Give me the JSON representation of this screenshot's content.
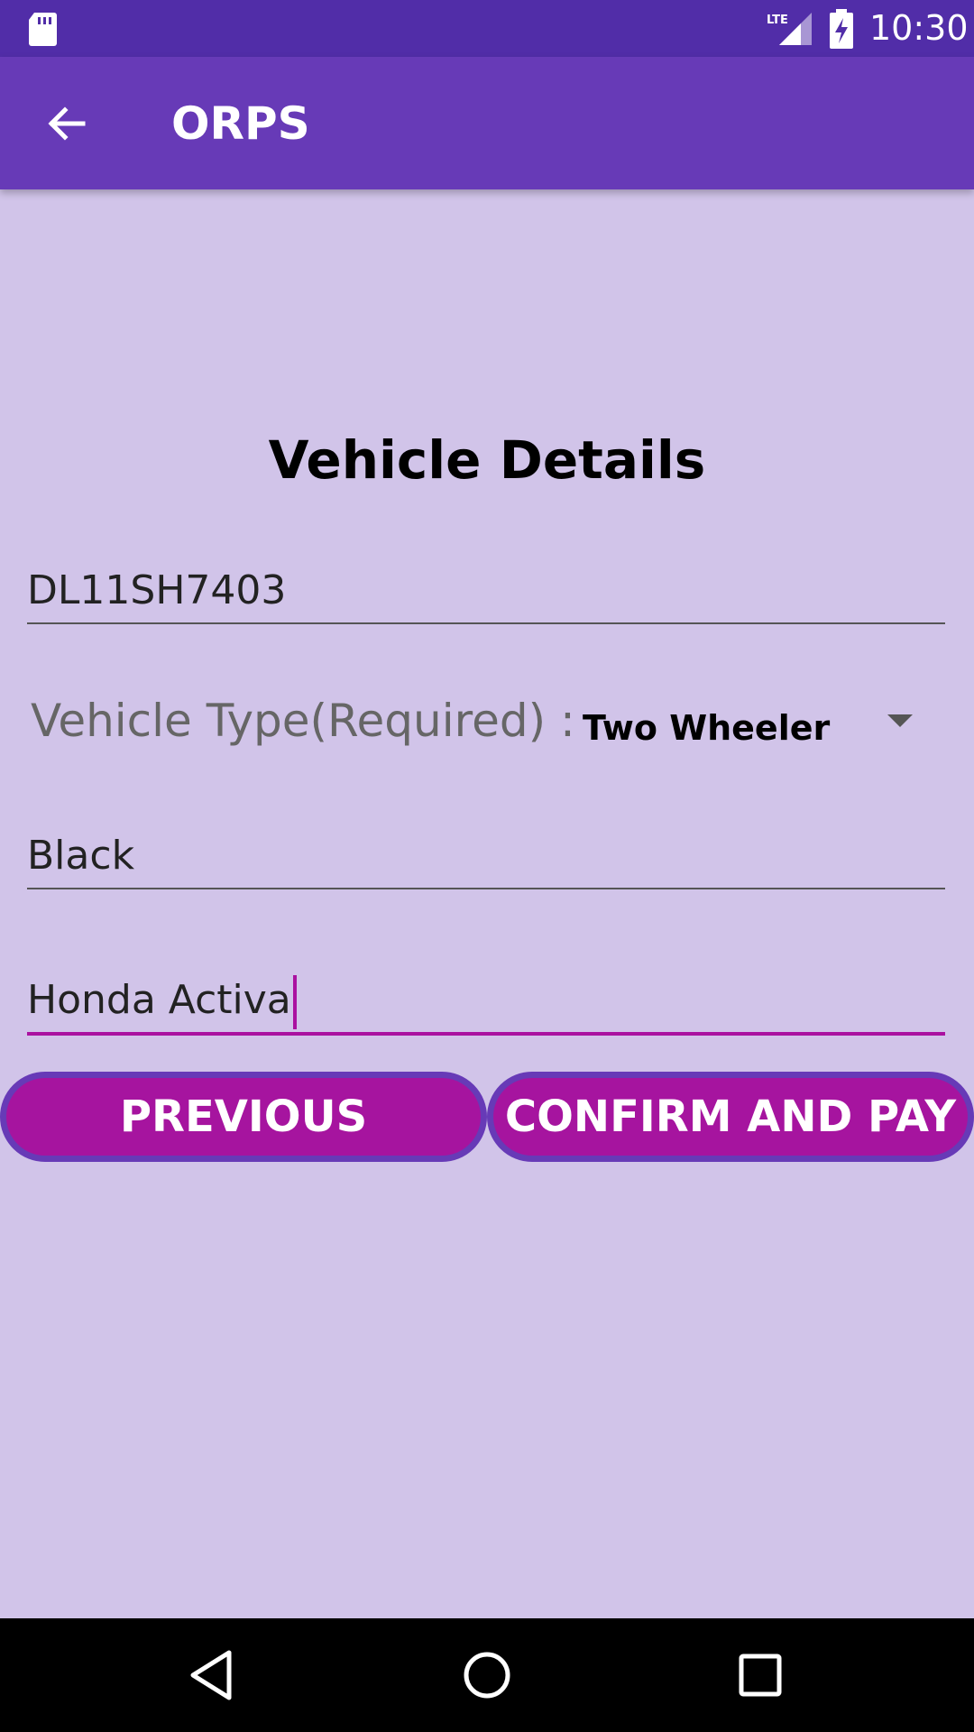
{
  "status_bar": {
    "time": "10:30",
    "network_label": "LTE",
    "icons": [
      "sd-card-icon",
      "lte-signal-icon",
      "battery-charging-icon"
    ]
  },
  "app_bar": {
    "title": "ORPS",
    "back_icon": "back-arrow-icon",
    "background": "#673ab7"
  },
  "form": {
    "heading": "Vehicle Details",
    "vehicle_number": "DL11SH7403",
    "vehicle_type_label": "Vehicle Type(Required) :",
    "vehicle_type_value": "Two Wheeler",
    "vehicle_color": "Black",
    "vehicle_model": "Honda Activa"
  },
  "buttons": {
    "previous": "PREVIOUS",
    "confirm": "CONFIRM AND PAY",
    "fill_color": "#a6149f"
  },
  "nav_bar": {
    "back_icon": "nav-back-icon",
    "home_icon": "nav-home-icon",
    "recents_icon": "nav-recents-icon"
  }
}
